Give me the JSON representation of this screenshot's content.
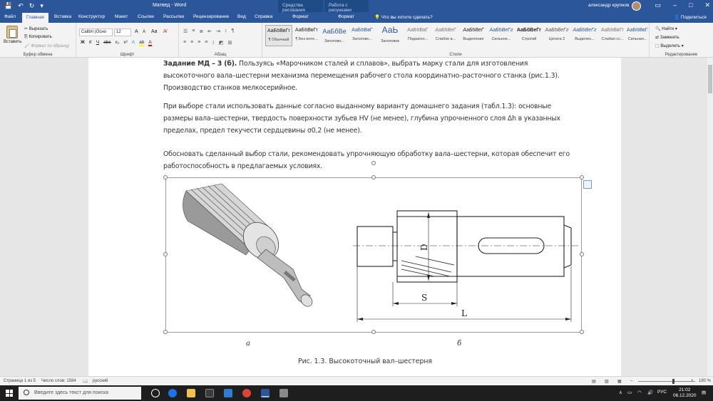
{
  "titlebar": {
    "doc_title": "Матвед  -  Word",
    "context_drawing": "Средства рисования",
    "context_picture": "Работа с рисунками",
    "user": "александр крупнов"
  },
  "tabs": [
    "Файл",
    "Главная",
    "Вставка",
    "Конструктор",
    "Макет",
    "Ссылки",
    "Рассылки",
    "Рецензирование",
    "Вид",
    "Справка",
    "Формат",
    "Формат"
  ],
  "tell_me": "Что вы хотите сделать?",
  "share": "Поделиться",
  "ribbon": {
    "clipboard": {
      "paste": "Вставить",
      "cut": "Вырезать",
      "copy": "Копировать",
      "format_painter": "Формат по образцу",
      "label": "Буфер обмена"
    },
    "font": {
      "name": "Calibri (Осно",
      "size": "12",
      "label": "Шрифт"
    },
    "paragraph_label": "Абзац",
    "styles_label": "Стили",
    "styles": [
      {
        "sample": "АаБбВвГг",
        "name": "¶ Обычный"
      },
      {
        "sample": "АаБбВвГг",
        "name": "¶ Без инте..."
      },
      {
        "sample": "АаБбВе",
        "name": "Заголово..."
      },
      {
        "sample": "АаБбВвГ",
        "name": "Заголово..."
      },
      {
        "sample": "АаЬ",
        "name": "Заголовок"
      },
      {
        "sample": "АаБбВвГ",
        "name": "Подзагол..."
      },
      {
        "sample": "АаБбВеГ",
        "name": "Слабое в..."
      },
      {
        "sample": "АаБбВеГ",
        "name": "Выделение"
      },
      {
        "sample": "АаБбВеГг",
        "name": "Сильное..."
      },
      {
        "sample": "АаБбВеГг",
        "name": "Строгий"
      },
      {
        "sample": "АаБбВеГг",
        "name": "Цитата 2"
      },
      {
        "sample": "АаБбВеГг",
        "name": "Выделен..."
      },
      {
        "sample": "АаБбВвГг",
        "name": "Слабая сс..."
      },
      {
        "sample": "АаБбВвГг",
        "name": "Сильная..."
      }
    ],
    "editing": {
      "find": "Найти",
      "replace": "Заменить",
      "select": "Выделить",
      "label": "Редактирование"
    }
  },
  "document": {
    "p1_bold": "Задание МД – 3 (б).",
    "p1": " Пользуясь «Марочником сталей и сплавов», выбрать марку стали для изготовления высокоточного вала–шестерни механизма перемещения рабочего стола координатно–расточного станка (рис.1.3). Производство станков мелкосерийное.",
    "p2": "При выборе стали использовать данные согласно выданному варианту домашнего задания (табл.1.3): основные размеры вала–шестерни, твердость поверхности зубьев HV (не менее), глубина упрочненного слоя Δh в указанных пределах, предел текучести сердцевины σ0,2 (не менее).",
    "p3": "Обосновать сделанный выбор стали, рекомендовать упрочняющую обработку вала–шестерни, которая обеспечит его работоспособность в предлагаемых условиях.",
    "label_a": "а",
    "label_b": "б",
    "dim_D": "D",
    "dim_S": "S",
    "dim_L": "L",
    "caption": "Рис. 1.3. Высокоточный вал–шестерня"
  },
  "statusbar": {
    "page": "Страница 1 из 5",
    "words": "Число слов: 1584",
    "lang": "русский",
    "zoom": "180 %",
    "zoom_percent": 180
  },
  "taskbar": {
    "search_placeholder": "Введите здесь текст для поиска",
    "lang": "РУС",
    "time": "21:02",
    "date": "06.12.2020"
  },
  "colors": {
    "word_blue": "#2b579a"
  }
}
